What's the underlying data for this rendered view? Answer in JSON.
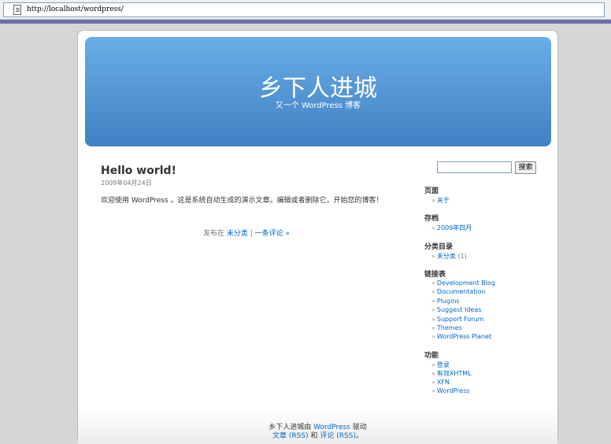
{
  "browser": {
    "url": "http://localhost/wordpress/"
  },
  "header": {
    "title": "乡下人进城",
    "description": "又一个 WordPress 博客"
  },
  "post": {
    "title": "Hello world!",
    "date": "2009年04月24日",
    "body": "欢迎使用 WordPress 。这是系统自动生成的演示文章。编辑或者删除它，开始您的博客！",
    "meta_prefix": "发布在",
    "category": "未分类",
    "separator": "|",
    "comments": "一条评论 »"
  },
  "search": {
    "button_label": "搜索",
    "value": ""
  },
  "sidebar": {
    "pages": {
      "heading": "页面",
      "items": [
        "关于"
      ]
    },
    "archives": {
      "heading": "存档",
      "items": [
        "2009年四月"
      ]
    },
    "categories": {
      "heading": "分类目录",
      "items": [
        {
          "label": "未分类",
          "count": "(1)"
        }
      ]
    },
    "links": {
      "heading": "链接表",
      "items": [
        "Development Blog",
        "Documentation",
        "Plugins",
        "Suggest Ideas",
        "Support Forum",
        "Themes",
        "WordPress Planet"
      ]
    },
    "meta": {
      "heading": "功能",
      "items": [
        "登录",
        "有效XHTML",
        "XFN",
        "WordPress"
      ]
    }
  },
  "footer": {
    "line1_prefix": "乡下人进城由",
    "wordpress": "WordPress",
    "line1_suffix": "驱动",
    "entries": "文章",
    "entries_rss": "(RSS)",
    "and": "和",
    "comments": "评论",
    "comments_rss": "(RSS)",
    "period": "。"
  },
  "colors": {
    "header_top": "#69aee7",
    "header_bottom": "#4180c3",
    "link": "#0066cc"
  }
}
